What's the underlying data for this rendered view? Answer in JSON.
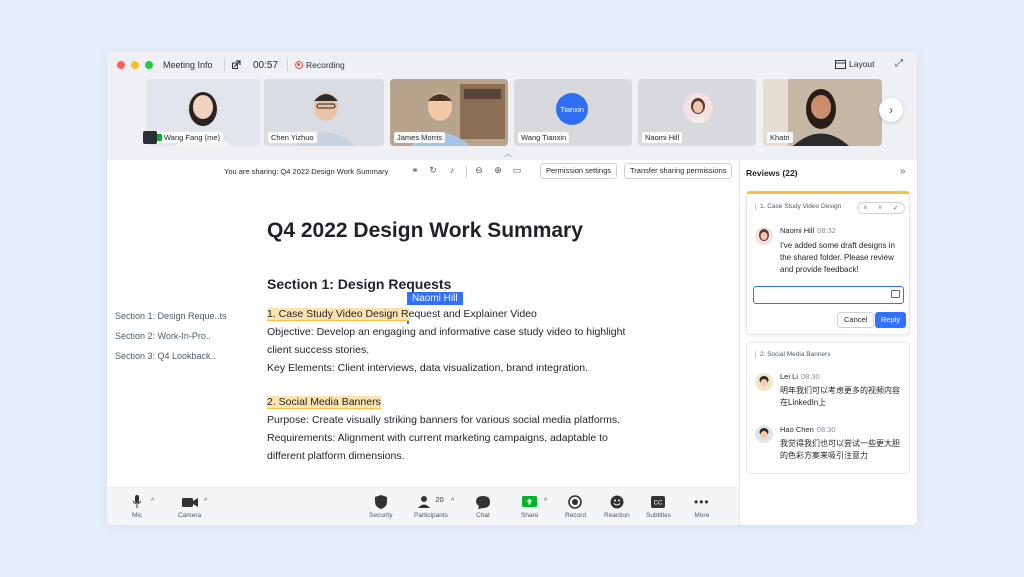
{
  "titlebar": {
    "title": "Meeting Info",
    "timer": "00:57",
    "recording": "Recording",
    "layout": "Layout"
  },
  "participants": [
    {
      "name": "Wang Fang (me)"
    },
    {
      "name": "Chen Yizhuo"
    },
    {
      "name": "James Morris"
    },
    {
      "name": "Wang Tianxin",
      "avatar_text": "Tianxin"
    },
    {
      "name": "Naomi Hill"
    },
    {
      "name": "Khatri"
    }
  ],
  "sharebar": {
    "sharing_text": "You are sharing: Q4 2022 Design Work Summary",
    "permission_settings": "Permission settings",
    "transfer_permissions": "Transfer sharing permissions"
  },
  "toc": [
    "Section 1: Design Reque..ts",
    "Section 2: Work-In-Pro..",
    "Section 3: Q4 Lookback.."
  ],
  "document": {
    "title": "Q4 2022 Design Work Summary",
    "section_title": "Section 1: Design Requests",
    "item1_highlight_a": "1. Case Study Video Design R",
    "item1_rest": "equest and Explainer Video",
    "item1_lines": [
      "Objective: Develop an engaging and informative case study video to highlight",
      "client success stories.",
      "Key Elements: Client interviews, data visualization, brand integration."
    ],
    "item2_title": "2. Social Media Banners",
    "item2_lines": [
      "Purpose: Create visually striking banners for various social media platforms.",
      "Requirements: Alignment with current marketing campaigns, adaptable to",
      "different platform dimensions."
    ],
    "cursor_user": "Naomi Hill"
  },
  "toolbar": {
    "mic": "Mic",
    "camera": "Camera",
    "security": "Security",
    "participants": "Participants",
    "participants_count": "20",
    "chat": "Chat",
    "share": "Share",
    "record": "Record",
    "reaction": "Reaction",
    "subtitles": "Subtitles",
    "more": "More"
  },
  "reviews": {
    "header": "Reviews (22)",
    "card1": {
      "quote": "1. Case Study Video Design",
      "author": "Naomi Hill",
      "time": "08:32",
      "text": "I've added some draft designs in the shared folder. Please review and provide feedback!",
      "cancel": "Cancel",
      "reply": "Reply"
    },
    "card2": {
      "quote": "2. Social Media Banners",
      "comments": [
        {
          "author": "Lei Li",
          "time": "08:30",
          "text": "明年我们可以考虑更多的视频内容在LinkedIn上"
        },
        {
          "author": "Hao Chen",
          "time": "08:30",
          "text": "我觉得我们也可以尝试一些更大胆的色彩方案来吸引注意力"
        }
      ]
    }
  },
  "colors": {
    "accent": "#3370ff",
    "highlight": "#fbe3b0",
    "highlight_border": "#f5c241",
    "share_green": "#00b42a",
    "record_red": "#f54a45"
  }
}
